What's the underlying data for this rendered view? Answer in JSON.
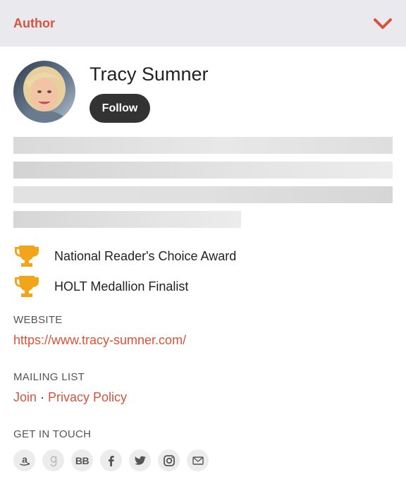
{
  "header": {
    "title": "Author",
    "toggle_icon": "chevron-down-icon",
    "accent_color": "#d9533a"
  },
  "author": {
    "name": "Tracy Sumner",
    "follow_label": "Follow"
  },
  "bio": {
    "loading": true,
    "placeholder_lines": 4
  },
  "awards": [
    {
      "icon": "trophy-icon",
      "label": "National Reader's Choice Award"
    },
    {
      "icon": "trophy-icon",
      "label": "HOLT Medallion Finalist"
    }
  ],
  "website": {
    "label": "WEBSITE",
    "url": "https://www.tracy-sumner.com/"
  },
  "mailing_list": {
    "label": "MAILING LIST",
    "join_label": "Join",
    "separator": "·",
    "privacy_label": "Privacy Policy"
  },
  "contact": {
    "label": "GET IN TOUCH",
    "icons": [
      "amazon-icon",
      "goodreads-icon",
      "bookbub-icon",
      "facebook-icon",
      "twitter-icon",
      "instagram-icon",
      "email-icon"
    ],
    "bookbub_text": "BB"
  }
}
